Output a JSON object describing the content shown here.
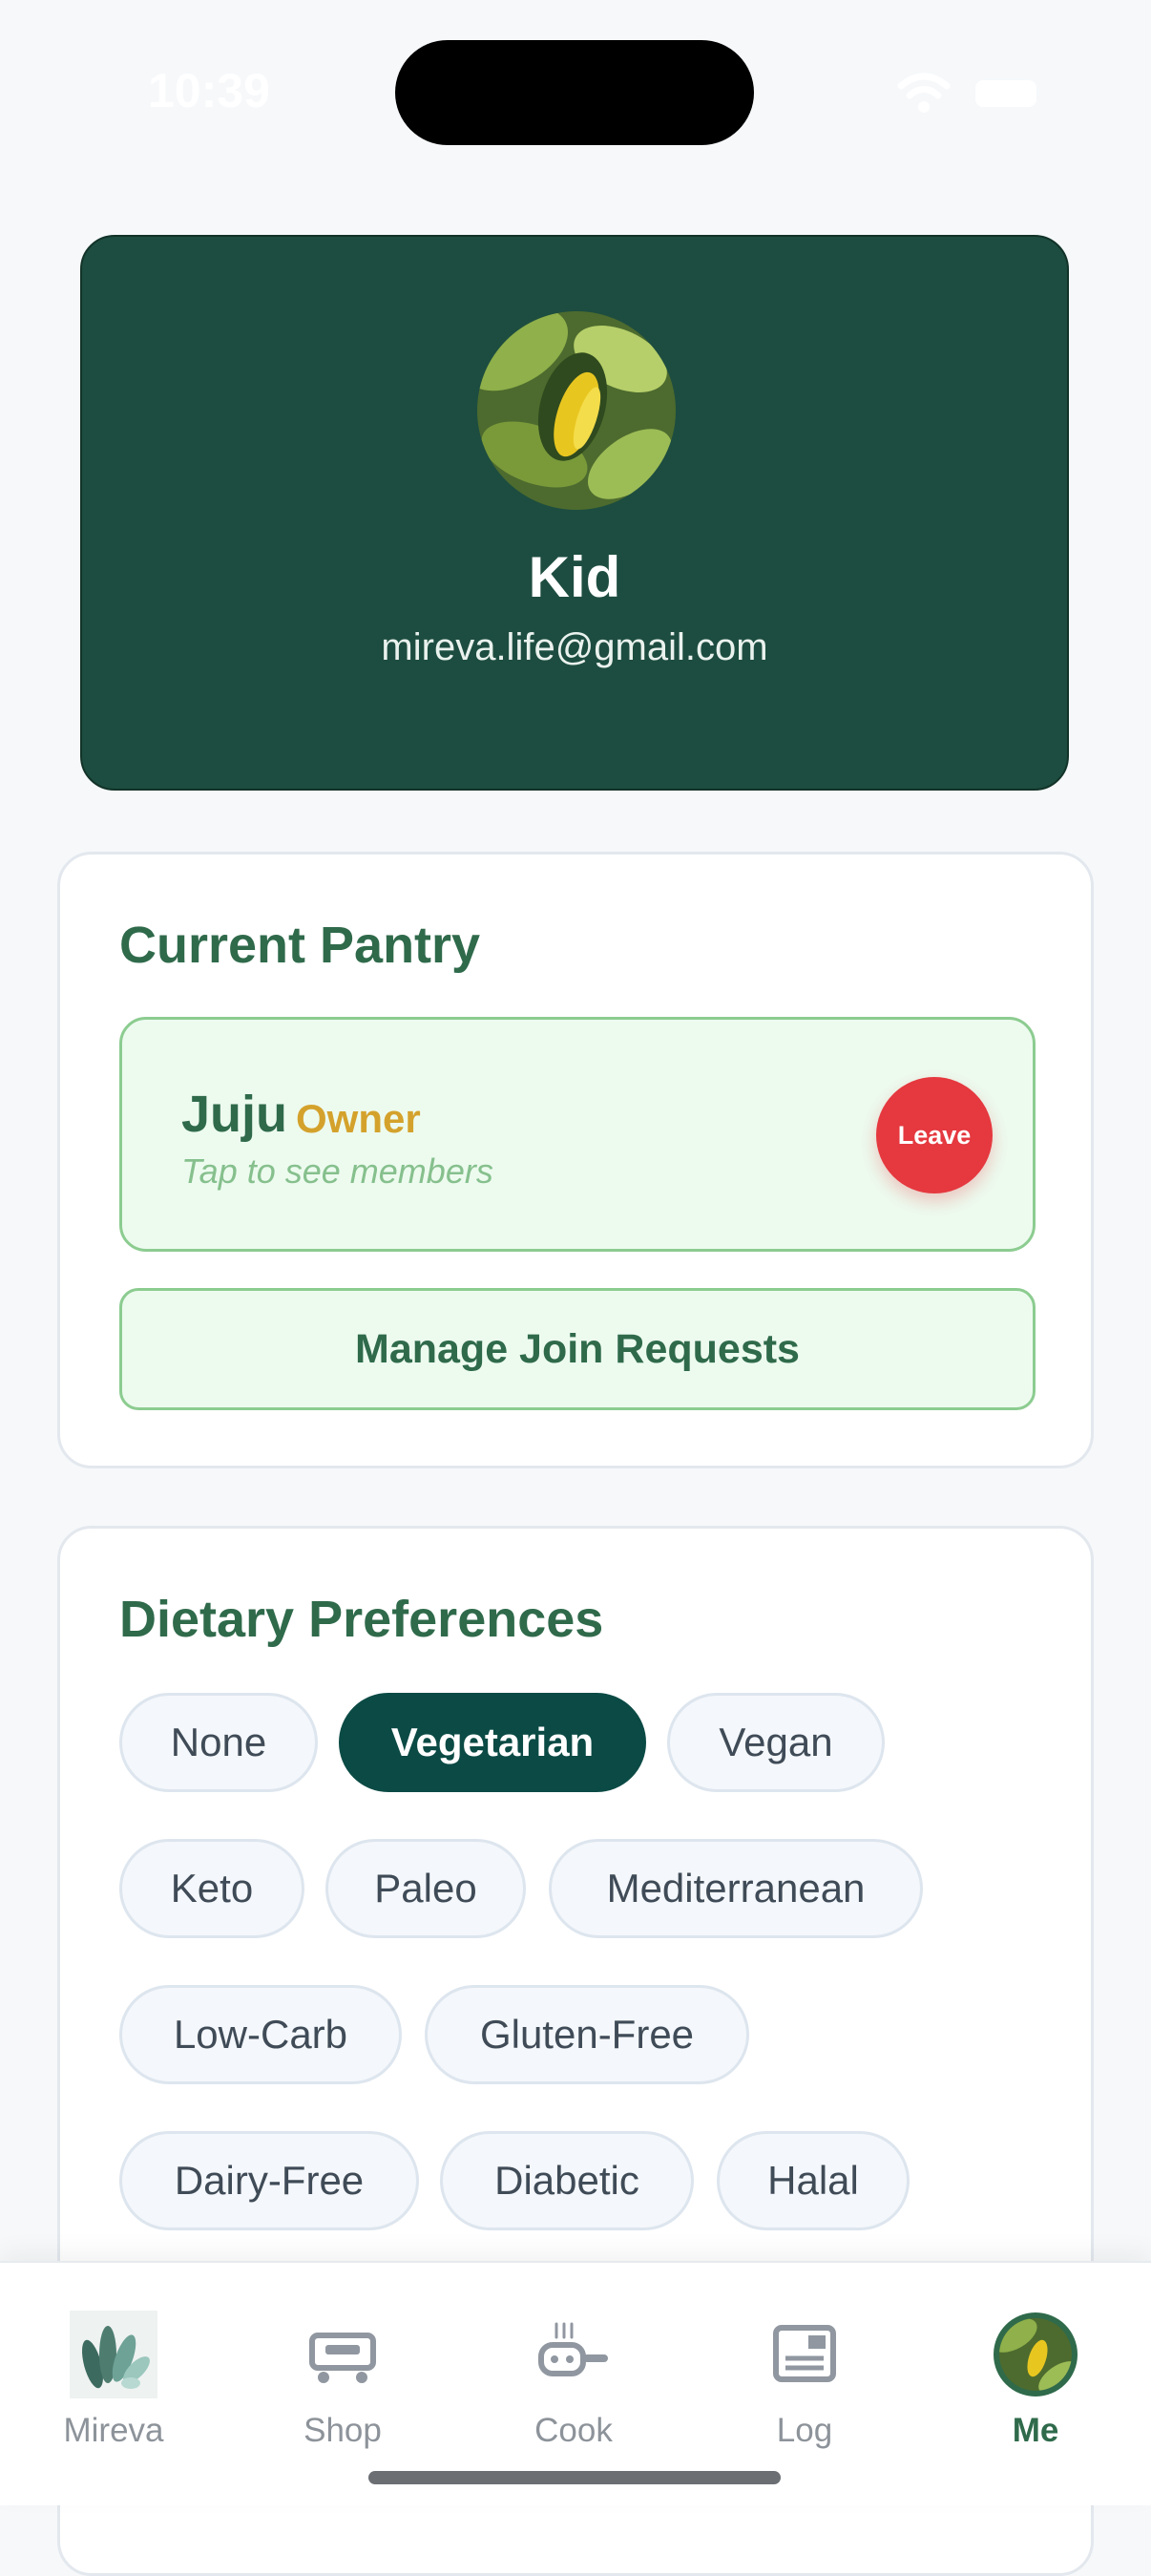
{
  "status_bar": {
    "time": "10:39"
  },
  "profile": {
    "name": "Kid",
    "email": "mireva.life@gmail.com"
  },
  "pantry_section": {
    "title": "Current Pantry",
    "pantry": {
      "name": "Juju",
      "role": "Owner",
      "hint": "Tap to see members",
      "leave_label": "Leave"
    },
    "manage_label": "Manage Join Requests"
  },
  "dietary_section": {
    "title": "Dietary Preferences",
    "options": [
      "None",
      "Vegetarian",
      "Vegan",
      "Keto",
      "Paleo",
      "Mediterranean",
      "Low-Carb",
      "Gluten-Free",
      "Dairy-Free",
      "Diabetic",
      "Halal"
    ],
    "selected": "Vegetarian"
  },
  "bottom_nav": {
    "items": [
      {
        "label": "Mireva",
        "icon": "mireva-logo-icon"
      },
      {
        "label": "Shop",
        "icon": "shopping-cart-icon"
      },
      {
        "label": "Cook",
        "icon": "cooking-pot-icon"
      },
      {
        "label": "Log",
        "icon": "log-book-icon"
      },
      {
        "label": "Me",
        "icon": "avatar-icon"
      }
    ],
    "active": "Me"
  },
  "colors": {
    "primary_dark": "#1d4d40",
    "accent_green": "#2f6a4b",
    "owner_gold": "#d4a22c",
    "leave_red": "#e5383f",
    "selected_chip": "#0b4a45"
  }
}
